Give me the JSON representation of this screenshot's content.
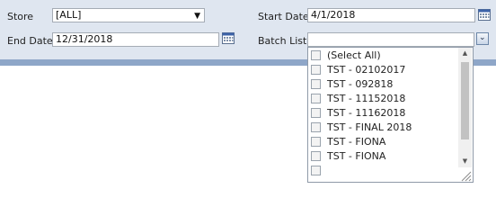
{
  "params": {
    "store": {
      "label": "Store",
      "value": "[ALL]"
    },
    "start_date": {
      "label": "Start Date",
      "value": "4/1/2018"
    },
    "end_date": {
      "label": "End Date",
      "value": "12/31/2018"
    },
    "batch_list": {
      "label": "Batch List",
      "value": ""
    }
  },
  "batch_options": [
    "(Select All)",
    "TST - 02102017",
    "TST - 092818",
    "TST - 11152018",
    "TST - 11162018",
    "TST - FINAL 2018",
    "TST - FIONA",
    "TST - FIONA"
  ],
  "colors": {
    "panel": "#dfe6f0",
    "panel_border": "#8ea6c8"
  },
  "icons": {
    "calendar": "calendar-icon",
    "dropdown": "chevron-down-icon"
  }
}
